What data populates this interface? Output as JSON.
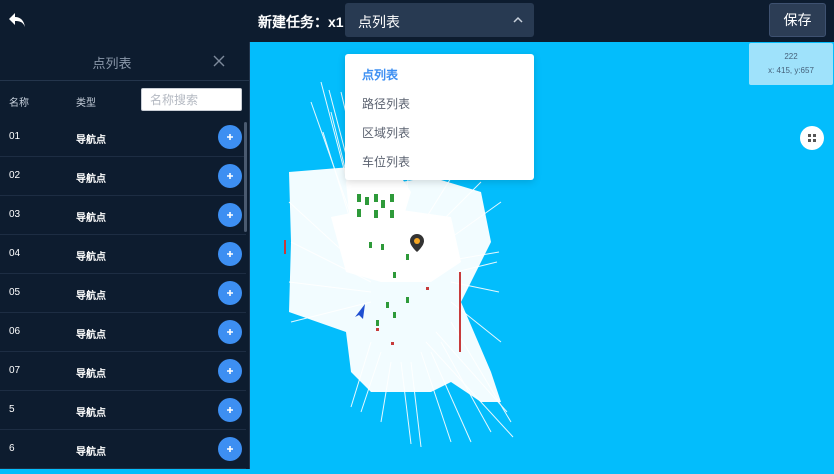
{
  "header": {
    "task_title": "新建任务：x1",
    "selected_list": "点列表",
    "save_label": "保存"
  },
  "panel": {
    "title": "点列表",
    "columns": {
      "name": "名称",
      "type": "类型"
    },
    "search_placeholder": "名称搜索",
    "rows": [
      {
        "name": "01",
        "type": "导航点"
      },
      {
        "name": "02",
        "type": "导航点"
      },
      {
        "name": "03",
        "type": "导航点"
      },
      {
        "name": "04",
        "type": "导航点"
      },
      {
        "name": "05",
        "type": "导航点"
      },
      {
        "name": "06",
        "type": "导航点"
      },
      {
        "name": "07",
        "type": "导航点"
      },
      {
        "name": "5",
        "type": "导航点"
      },
      {
        "name": "6",
        "type": "导航点"
      }
    ]
  },
  "dropdown": {
    "options": [
      "点列表",
      "路径列表",
      "区域列表",
      "车位列表"
    ],
    "active": "点列表"
  },
  "coord_tip": {
    "label": "222",
    "coords": "x: 415, y:657"
  },
  "colors": {
    "map_bg": "#03bdfc",
    "panel_bg": "#0d1c2f",
    "accent": "#3d8ff2"
  }
}
